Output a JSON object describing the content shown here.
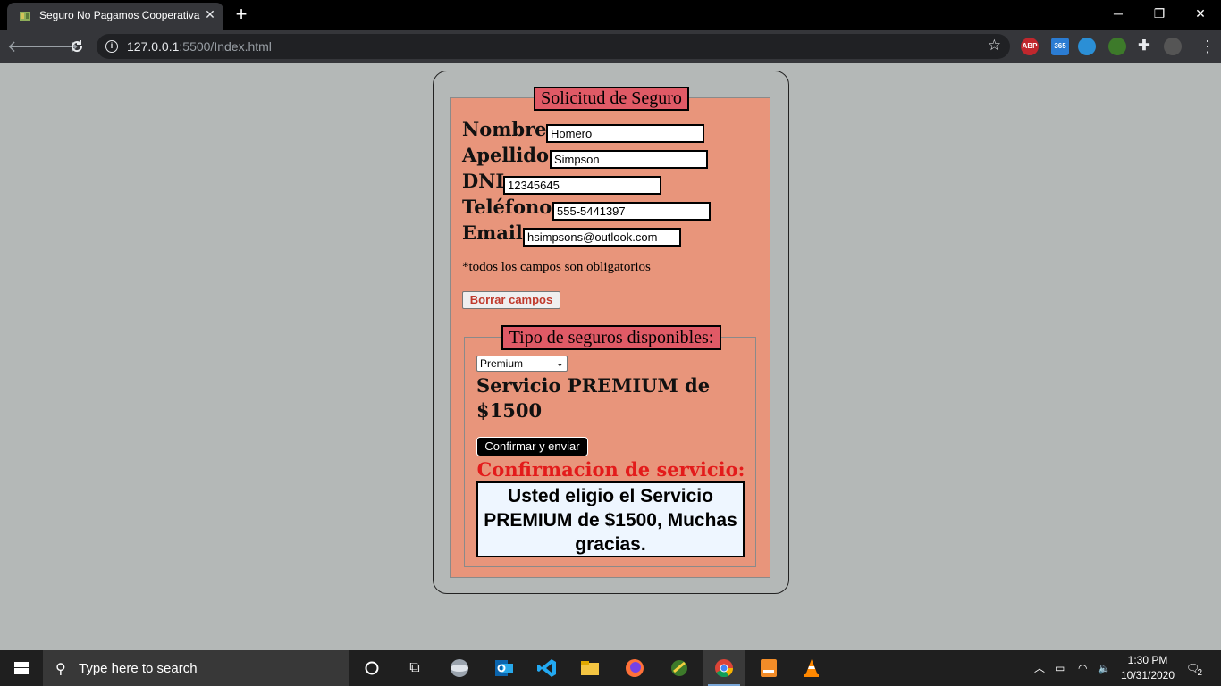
{
  "browser": {
    "tab_title": "Seguro No Pagamos Cooperativa",
    "url_host": "127.0.0.1",
    "url_rest": ":5500/Index.html",
    "extensions": [
      "ABP",
      "365"
    ]
  },
  "form": {
    "legend": "Solicitud de Seguro",
    "fields": [
      {
        "label": "Nombre",
        "value": "Homero"
      },
      {
        "label": "Apellido",
        "value": "Simpson"
      },
      {
        "label": "DNI",
        "value": "12345645"
      },
      {
        "label": "Teléfono",
        "value": "555-5441397"
      },
      {
        "label": "Email",
        "value": "hsimpsons@outlook.com"
      }
    ],
    "note": "*todos los campos son obligatorios",
    "clear_button": "Borrar campos"
  },
  "insurance": {
    "legend": "Tipo de seguros disponibles:",
    "selected_option": "Premium",
    "service_text": "Servicio PREMIUM de $1500",
    "confirm_button": "Confirmar y enviar",
    "confirm_title": "Confirmacion de servicio:",
    "result_text": "Usted eligio el Servicio PREMIUM de $1500, Muchas gracias."
  },
  "taskbar": {
    "search_placeholder": "Type here to search",
    "time": "1:30 PM",
    "date": "10/31/2020",
    "notifications": "2"
  },
  "colors": {
    "page_bg": "#b4b8b7",
    "form_bg": "#e8957b",
    "legend_bg": "#e05a66",
    "confirm_title": "#e31b1b",
    "result_bg": "#eef6ff"
  }
}
